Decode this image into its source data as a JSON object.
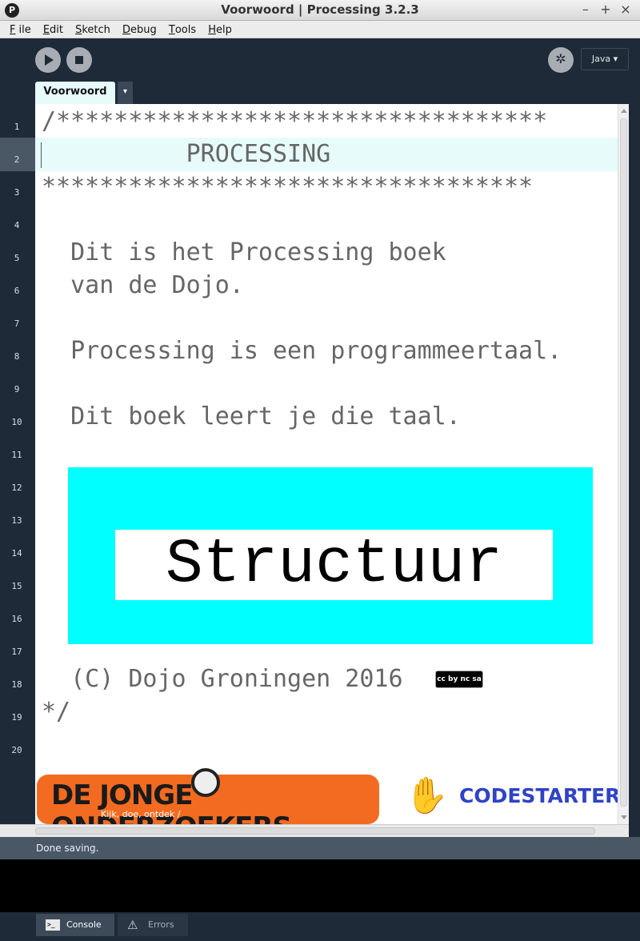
{
  "window": {
    "title": "Voorwoord | Processing 3.2.3",
    "app_icon": "P",
    "controls": [
      "–",
      "+",
      "×"
    ]
  },
  "menu": {
    "items": [
      {
        "key": "F",
        "rest": "ile"
      },
      {
        "key": "E",
        "rest": "dit"
      },
      {
        "key": "S",
        "rest": "ketch"
      },
      {
        "key": "D",
        "rest": "ebug"
      },
      {
        "key": "T",
        "rest": "ools"
      },
      {
        "key": "H",
        "rest": "elp"
      }
    ]
  },
  "toolbar": {
    "icons": [
      "play-icon",
      "stop-icon",
      "debugger-icon"
    ],
    "mode_label": "Java ▾"
  },
  "tabs": {
    "active": "Voorwoord",
    "menu_arrow": "▾"
  },
  "editor": {
    "line_numbers": [
      "1",
      "2",
      "3",
      "4",
      "5",
      "6",
      "7",
      "8",
      "9",
      "10",
      "11",
      "12",
      "13",
      "14",
      "15",
      "16",
      "17",
      "18",
      "19",
      "20"
    ],
    "lines": [
      "/**********************************",
      "          PROCESSING",
      "**********************************",
      "",
      "  Dit is het Processing boek",
      "  van de Dojo.",
      "",
      "  Processing is een programmeertaal.",
      "",
      "  Dit boek leert je die taal.",
      "",
      "",
      "",
      "",
      "",
      "",
      "",
      "  (C) Dojo Groningen 2016",
      "*/",
      ""
    ],
    "banner_text": "Structuur",
    "license_badge": "cc by nc sa",
    "colors": {
      "banner_bg": "#00ffff",
      "highlight": "#e7fbfb",
      "background": "#1e2a38"
    }
  },
  "logos": {
    "djo_title": "DE JONGE ONDERZOEKERS",
    "djo_subtitle": "Kijk, doe, ontdek /",
    "codestarter": "CODESTARTER",
    "colors": {
      "djo": "#f26b21",
      "codestarter": "#2f43c4"
    }
  },
  "status": {
    "message": "Done saving."
  },
  "bottom_tabs": {
    "console": "Console",
    "errors": "Errors"
  }
}
